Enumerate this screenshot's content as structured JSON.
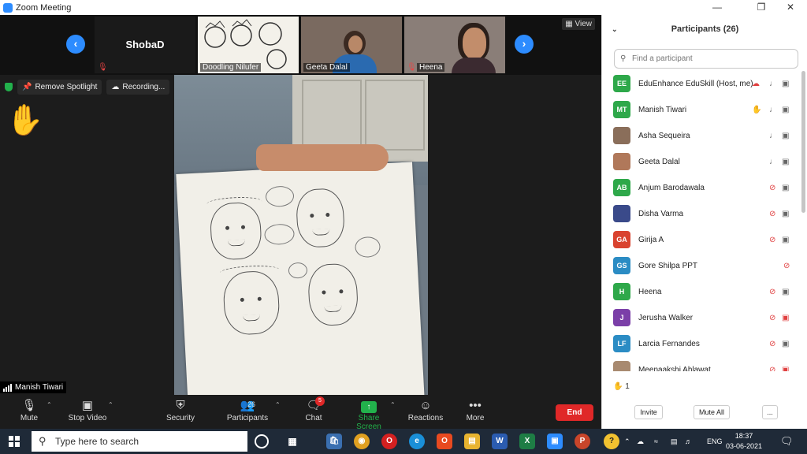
{
  "window": {
    "title": "Zoom Meeting"
  },
  "thumbnails": {
    "speaker_name": "ShobaD",
    "tiles": [
      "Doodling Nilufer",
      "Geeta Dalal",
      "Heena"
    ],
    "view_label": "View"
  },
  "spotlight": {
    "remove_label": "Remove Spotlight",
    "recording_label": "Recording..."
  },
  "main_video": {
    "name": "Manish Tiwari"
  },
  "toolbar": {
    "mute": "Mute",
    "stop_video": "Stop Video",
    "security": "Security",
    "participants": "Participants",
    "participants_count": "26",
    "chat": "Chat",
    "chat_badge": "5",
    "share_screen": "Share Screen",
    "reactions": "Reactions",
    "more": "More",
    "end": "End"
  },
  "panel": {
    "title": "Participants (26)",
    "search_placeholder": "Find a participant",
    "participants": [
      {
        "initials": "EE",
        "name": "EduEnhance EduSkill (Host, me)",
        "color": "#2ea84a",
        "mic": "on",
        "video": "on",
        "photo": false
      },
      {
        "initials": "MT",
        "name": "Manish Tiwari",
        "color": "#2ea84a",
        "mic": "on",
        "video": "on",
        "photo": false,
        "hand": true
      },
      {
        "initials": "",
        "name": "Asha Sequeira",
        "color": "#8a6e5a",
        "mic": "on",
        "video": "on",
        "photo": true
      },
      {
        "initials": "",
        "name": "Geeta Dalal",
        "color": "#b0785a",
        "mic": "on",
        "video": "on",
        "photo": true
      },
      {
        "initials": "AB",
        "name": "Anjum Barodawala",
        "color": "#2ea84a",
        "mic": "off",
        "video": "on",
        "photo": false
      },
      {
        "initials": "",
        "name": "Disha Varma",
        "color": "#3a4a8a",
        "mic": "off",
        "video": "on",
        "photo": true
      },
      {
        "initials": "GA",
        "name": "Girija A",
        "color": "#d9432f",
        "mic": "off",
        "video": "on",
        "photo": false
      },
      {
        "initials": "GS",
        "name": "Gore Shilpa PPT",
        "color": "#2b8cc4",
        "mic": "off",
        "video": "none",
        "photo": false
      },
      {
        "initials": "H",
        "name": "Heena",
        "color": "#2ea84a",
        "mic": "off",
        "video": "on",
        "photo": false
      },
      {
        "initials": "J",
        "name": "Jerusha Walker",
        "color": "#7b3fa8",
        "mic": "off",
        "video": "off",
        "photo": false
      },
      {
        "initials": "LF",
        "name": "Larcia Fernandes",
        "color": "#2b8cc4",
        "mic": "off",
        "video": "on",
        "photo": false
      },
      {
        "initials": "",
        "name": "Meenaakshi Ahlawat",
        "color": "#a88a70",
        "mic": "off",
        "video": "off",
        "photo": true
      }
    ],
    "raised_hands": "1",
    "buttons": {
      "invite": "Invite",
      "mute_all": "Mute All",
      "more": "..."
    }
  },
  "taskbar": {
    "search_placeholder": "Type here to search",
    "lang": "ENG",
    "time": "18:37",
    "date": "03-06-2021"
  }
}
